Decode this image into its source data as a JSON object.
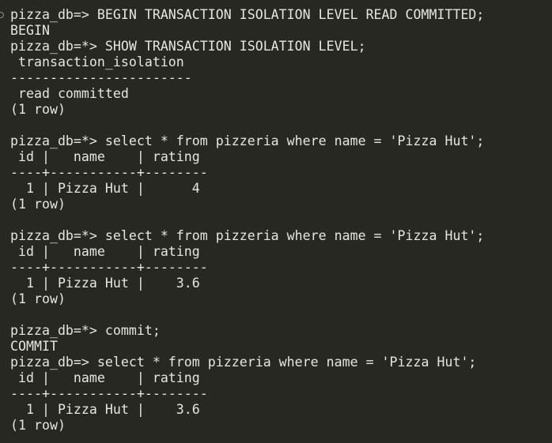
{
  "terminal": {
    "lines": [
      "pizza_db=> BEGIN TRANSACTION ISOLATION LEVEL READ COMMITTED;",
      "BEGIN",
      "pizza_db=*> SHOW TRANSACTION ISOLATION LEVEL;",
      " transaction_isolation",
      "-----------------------",
      " read committed",
      "(1 row)",
      "",
      "pizza_db=*> select * from pizzeria where name = 'Pizza Hut';",
      " id |   name    | rating",
      "----+-----------+--------",
      "  1 | Pizza Hut |      4",
      "(1 row)",
      "",
      "pizza_db=*> select * from pizzeria where name = 'Pizza Hut';",
      " id |   name    | rating",
      "----+-----------+--------",
      "  1 | Pizza Hut |    3.6",
      "(1 row)",
      "",
      "pizza_db=*> commit;",
      "COMMIT",
      "pizza_db=> select * from pizzeria where name = 'Pizza Hut';",
      " id |   name    | rating",
      "----+-----------+--------",
      "  1 | Pizza Hut |    3.6",
      "(1 row)"
    ]
  },
  "colors": {
    "background": "#272822",
    "text": "#e6e6e1"
  }
}
